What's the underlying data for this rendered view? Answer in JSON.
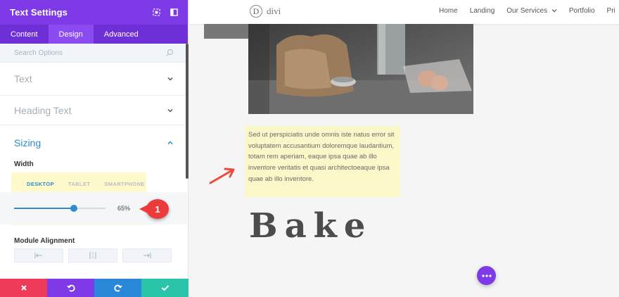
{
  "panel": {
    "title": "Text Settings",
    "header_icons": [
      "expand-icon",
      "sidebar-icon"
    ],
    "tabs": [
      {
        "label": "Content",
        "active": false
      },
      {
        "label": "Design",
        "active": true
      },
      {
        "label": "Advanced",
        "active": false
      }
    ],
    "search_placeholder": "Search Options",
    "sections": [
      {
        "title": "Text",
        "expanded": false
      },
      {
        "title": "Heading Text",
        "expanded": false
      },
      {
        "title": "Sizing",
        "expanded": true
      }
    ],
    "width_label": "Width",
    "device_tabs": [
      {
        "label": "DESKTOP",
        "active": true
      },
      {
        "label": "TABLET",
        "active": false
      },
      {
        "label": "SMARTPHONE",
        "active": false
      }
    ],
    "width_value": "65%",
    "width_fraction": 0.65,
    "callout_number": "1",
    "module_alignment_label": "Module Alignment",
    "alignment_options": [
      "align-left-icon",
      "align-center-icon",
      "align-right-icon"
    ],
    "footer_buttons": [
      {
        "icon": "close-icon",
        "color": "#ef3b5a"
      },
      {
        "icon": "undo-icon",
        "color": "#7d3ae6"
      },
      {
        "icon": "redo-icon",
        "color": "#2b87da"
      },
      {
        "icon": "check-icon",
        "color": "#29c4a9"
      }
    ],
    "colors": {
      "header": "#7d3ae6",
      "accent": "#2d8ccc"
    }
  },
  "site": {
    "logo_letter": "D",
    "logo_text": "divi",
    "nav_links": [
      "Home",
      "Landing",
      "Our Services",
      "Portfolio",
      "Pri"
    ],
    "body_text": "Sed ut perspiciatis unde omnis iste natus error sit voluptatem accusantium doloremque laudantium, totam rem aperiam, eaque ipsa quae ab illo inventore veritatis et quasi architectoeaque ipsa quae ab illo inventore.",
    "heading": "Bake",
    "fab_icon": "more-dots-icon"
  }
}
